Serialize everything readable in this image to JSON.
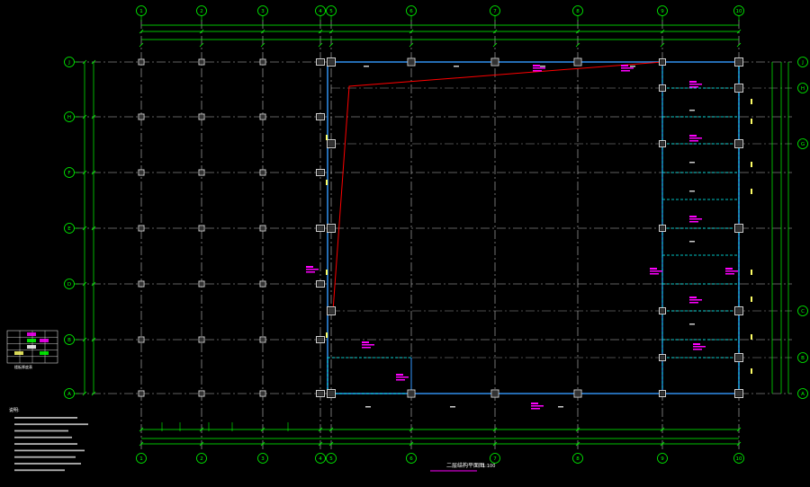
{
  "drawing": {
    "background": "#000000",
    "colors": {
      "grid": "#ffffff",
      "axis_bubble": "#00ff00",
      "dimension": "#00ff00",
      "beam": "#3399ff",
      "column": "#d0d0d0",
      "annotation": "#ff00ff",
      "section_line": "#ff0000",
      "secondary": "#00ffff"
    },
    "columns_axes": [
      "1",
      "2",
      "3",
      "4",
      "5",
      "6",
      "7",
      "8",
      "9",
      "10"
    ],
    "row_axes": [
      "J",
      "H",
      "F",
      "E",
      "D",
      "B",
      "A"
    ],
    "right_row_axes": [
      "J",
      "H",
      "G",
      "",
      "C",
      "B",
      "A"
    ],
    "title": "二层结构平面图",
    "scale": "1:100",
    "notes_heading": "说明:",
    "legend_caption": "楼板厚度表"
  }
}
